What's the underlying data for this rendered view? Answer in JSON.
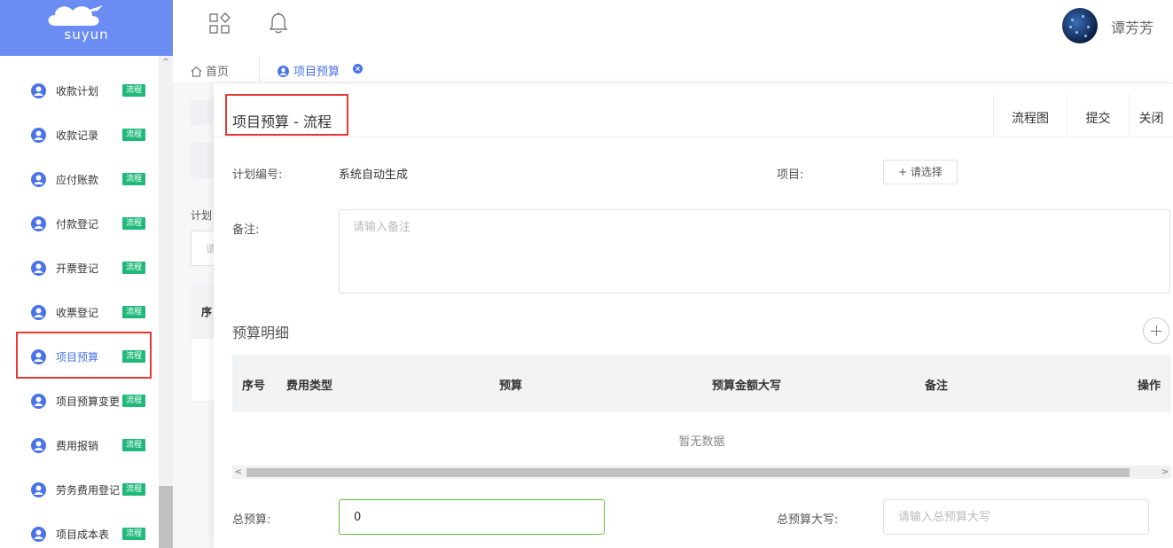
{
  "logo": {
    "text": "suyun"
  },
  "user": {
    "name": "谭芳芳"
  },
  "sidebar": {
    "items": [
      {
        "label": "收款计划",
        "tag": "流程"
      },
      {
        "label": "收款记录",
        "tag": "流程"
      },
      {
        "label": "应付账款",
        "tag": "流程"
      },
      {
        "label": "付款登记",
        "tag": "流程"
      },
      {
        "label": "开票登记",
        "tag": "流程"
      },
      {
        "label": "收票登记",
        "tag": "流程"
      },
      {
        "label": "项目预算",
        "tag": "流程",
        "active": true
      },
      {
        "label": "项目预算变更",
        "tag": "流程"
      },
      {
        "label": "费用报销",
        "tag": "流程"
      },
      {
        "label": "劳务费用登记",
        "tag": "流程"
      },
      {
        "label": "项目成本表",
        "tag": "流程"
      }
    ]
  },
  "tabs": {
    "home": "首页",
    "active": "项目预算"
  },
  "background": {
    "label_plan": "计划",
    "input_hint": "请",
    "table_col": "序"
  },
  "drawer": {
    "title": "项目预算  -  流程",
    "buttons": {
      "flow_chart": "流程图",
      "submit": "提交",
      "close": "关闭"
    },
    "plan_no_label": "计划编号:",
    "plan_no_value": "系统自动生成",
    "project_label": "项目:",
    "project_select": "+ 请选择",
    "remark_label": "备注:",
    "remark_placeholder": "请输入备注",
    "detail_title": "预算明细",
    "table": {
      "headers": [
        "序号",
        "费用类型",
        "预算",
        "预算金额大写",
        "备注",
        "操作"
      ],
      "empty": "暂无数据"
    },
    "total_label": "总预算:",
    "total_value": "0",
    "total_upper_label": "总预算大写:",
    "total_upper_placeholder": "请输入总预算大写"
  },
  "colors": {
    "brand": "#6b8cf2",
    "active": "#4a73e8",
    "tag": "#20b97a",
    "highlight": "#e53935",
    "input_focus": "#5fbf3c"
  },
  "icons": [
    "apps-icon",
    "bell-icon",
    "home-icon",
    "user-icon",
    "close-icon",
    "plus-icon"
  ]
}
